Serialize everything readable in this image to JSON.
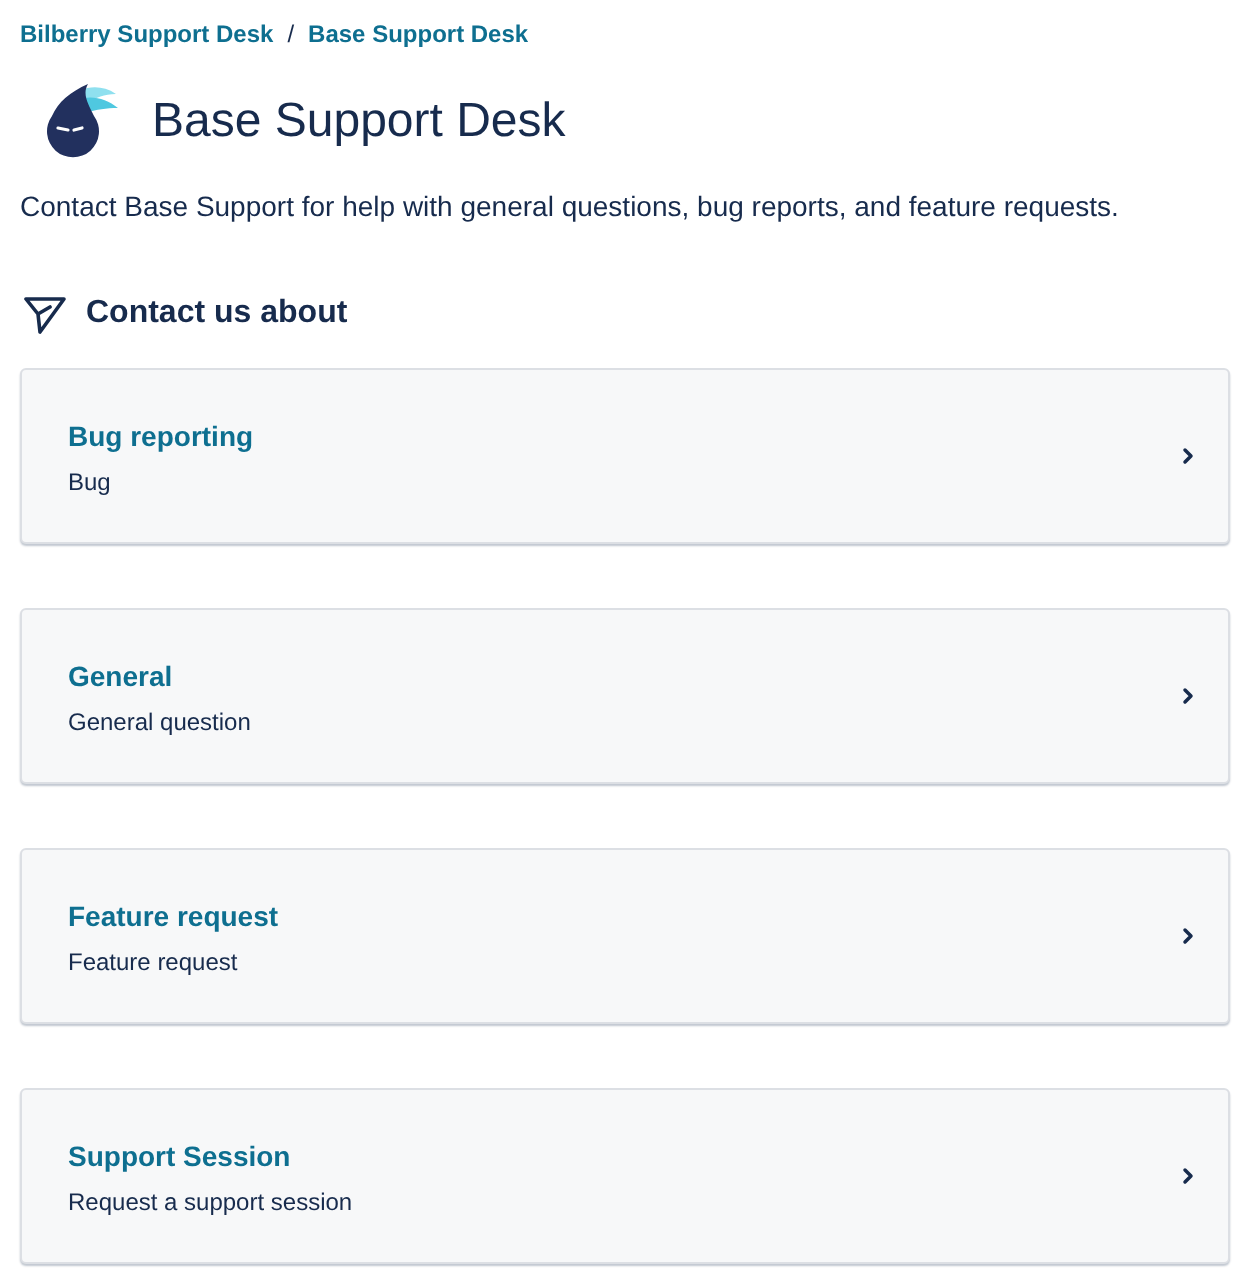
{
  "breadcrumbs": {
    "items": [
      {
        "label": "Bilberry Support Desk"
      },
      {
        "label": "Base Support Desk"
      }
    ],
    "separator": "/"
  },
  "header": {
    "title": "Base Support Desk",
    "description": "Contact Base Support for help with general questions, bug reports, and feature requests."
  },
  "section": {
    "title": "Contact us about",
    "request_types": [
      {
        "name": "Bug reporting",
        "description": "Bug"
      },
      {
        "name": "General",
        "description": "General question"
      },
      {
        "name": "Feature request",
        "description": "Feature request"
      },
      {
        "name": "Support Session",
        "description": "Request a support session"
      }
    ]
  }
}
